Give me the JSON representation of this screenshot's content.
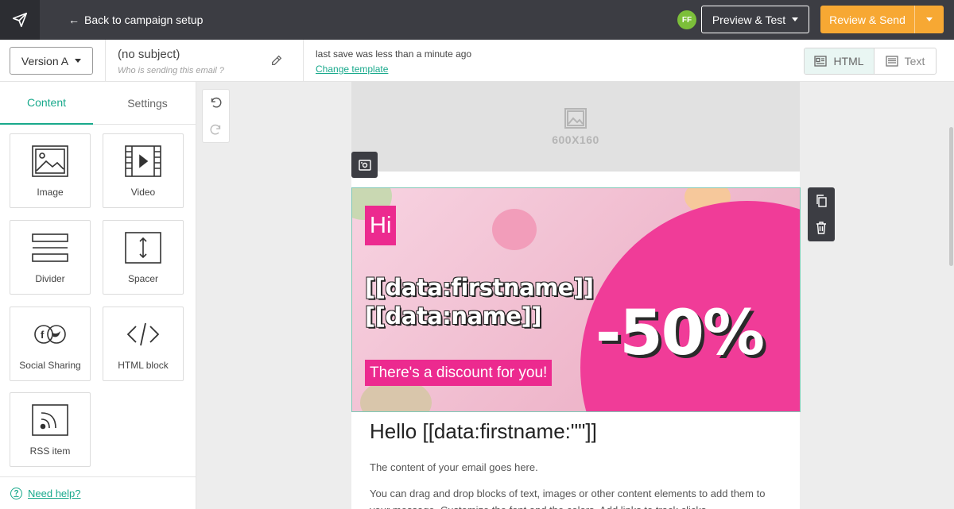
{
  "topbar": {
    "back_label": "Back to campaign setup",
    "avatar_initials": "FF",
    "avatar_color": "#7cbf3a",
    "preview_label": "Preview & Test",
    "review_label": "Review & Send",
    "review_color": "#f7a833"
  },
  "subbar": {
    "version_label": "Version A",
    "subject": "(no subject)",
    "sender_placeholder": "Who is sending this email ?",
    "save_status": "last save was less than a minute ago",
    "change_template": "Change template",
    "html_label": "HTML",
    "text_label": "Text"
  },
  "sidebar": {
    "tabs": [
      {
        "label": "Content",
        "active": true
      },
      {
        "label": "Settings",
        "active": false
      }
    ],
    "blocks": [
      {
        "label": "Image",
        "icon": "image-icon"
      },
      {
        "label": "Video",
        "icon": "video-icon"
      },
      {
        "label": "Divider",
        "icon": "divider-icon"
      },
      {
        "label": "Spacer",
        "icon": "spacer-icon"
      },
      {
        "label": "Social Sharing",
        "icon": "social-sharing-icon"
      },
      {
        "label": "HTML block",
        "icon": "code-icon"
      },
      {
        "label": "RSS item",
        "icon": "rss-icon"
      }
    ],
    "help_label": "Need help?"
  },
  "canvas": {
    "placeholder_size": "600X160",
    "banner": {
      "hi": "Hi",
      "merge_line_1": "[[data:firstname]]",
      "merge_line_2": "[[data:name]]",
      "discount": "There's a discount for you!",
      "percent": "-50%",
      "accent_color": "#f03c98"
    },
    "heading": "Hello [[data:firstname:\"\"]]",
    "paragraph_1": "The content of your email goes here.",
    "paragraph_2": "You can drag and drop blocks of text, images or other content elements to add them to your message. Customize the font and the colors. Add links to track clicks."
  },
  "accent_color": "#19a98c"
}
